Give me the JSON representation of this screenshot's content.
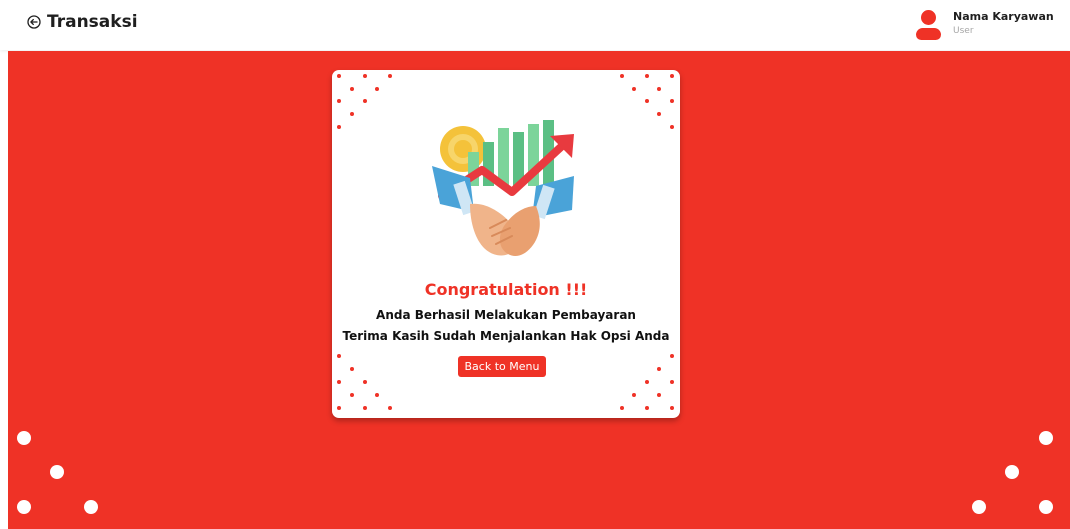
{
  "header": {
    "title": "Transaksi",
    "back_icon": "arrow-left-circle-icon",
    "user_name": "Nama Karyawan",
    "user_role": "User",
    "avatar_icon": "user-icon"
  },
  "card": {
    "illustration": "handshake-growth-chart-illustration",
    "heading": "Congratulation !!!",
    "message_line1": "Anda Berhasil Melakukan Pembayaran",
    "message_line2": "Terima Kasih Sudah Menjalankan Hak Opsi Anda",
    "button_label": "Back to Menu"
  },
  "colors": {
    "accent": "#ef3226",
    "background": "#ffffff",
    "text": "#1f1f1f",
    "muted": "#a7a7a7"
  }
}
